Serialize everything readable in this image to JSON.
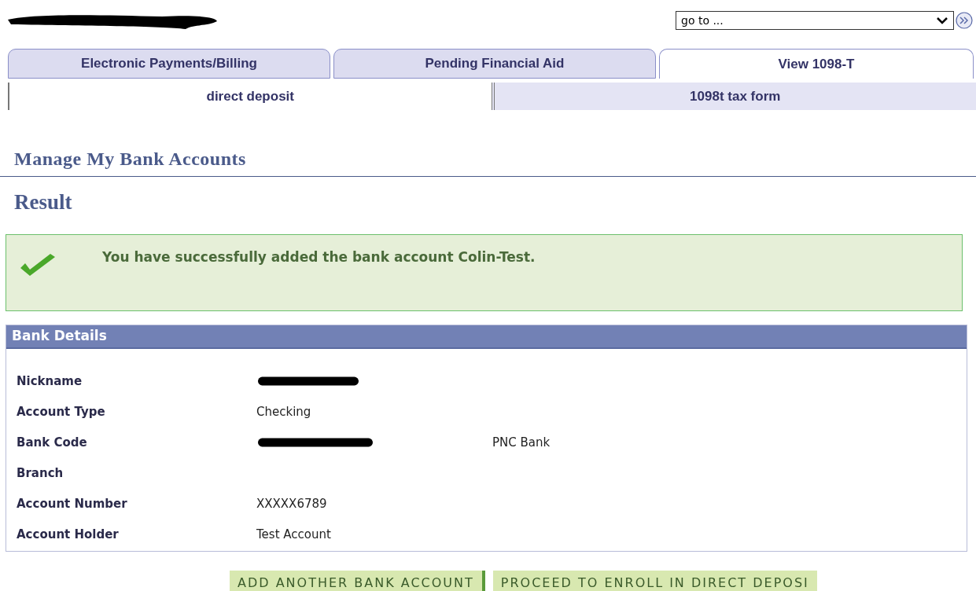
{
  "goto": {
    "value": "go to ..."
  },
  "tabs": [
    {
      "label": "Electronic Payments/Billing",
      "selected": false
    },
    {
      "label": "Pending Financial Aid",
      "selected": false
    },
    {
      "label": "View 1098-T",
      "selected": true
    }
  ],
  "subtabs": [
    {
      "label": "direct deposit",
      "selected": true
    },
    {
      "label": "1098t tax form",
      "selected": false
    }
  ],
  "page_title": "Manage My Bank Accounts",
  "section_title": "Result",
  "message": "You have successfully added the bank account Colin-Test.",
  "bank_details": {
    "title": "Bank Details",
    "rows": [
      {
        "label": "Nickname",
        "redacted": true
      },
      {
        "label": "Account Type",
        "value": "Checking",
        "redacted": false
      },
      {
        "label": "Bank Code",
        "redacted": true,
        "extra": "PNC Bank"
      },
      {
        "label": "Branch",
        "redacted": false
      },
      {
        "label": "Account Number",
        "value": "XXXXX6789",
        "redacted": false
      },
      {
        "label": "Account Holder",
        "value": "Test Account",
        "redacted": false
      }
    ]
  },
  "buttons": [
    "ADD ANOTHER BANK ACCOUNT",
    "PROCEED TO ENROLL IN DIRECT DEPOSI"
  ]
}
